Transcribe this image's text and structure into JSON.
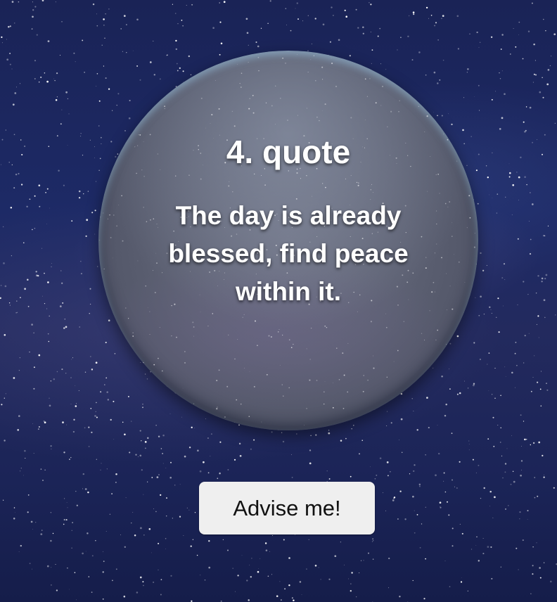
{
  "quote_card": {
    "title": "4. quote",
    "text": "The day is already blessed, find peace within it."
  },
  "actions": {
    "advise_label": "Advise me!"
  },
  "colors": {
    "background": "#1d2a66",
    "orb": "#5d6173",
    "button_bg": "#efefef",
    "text": "#ffffff"
  }
}
